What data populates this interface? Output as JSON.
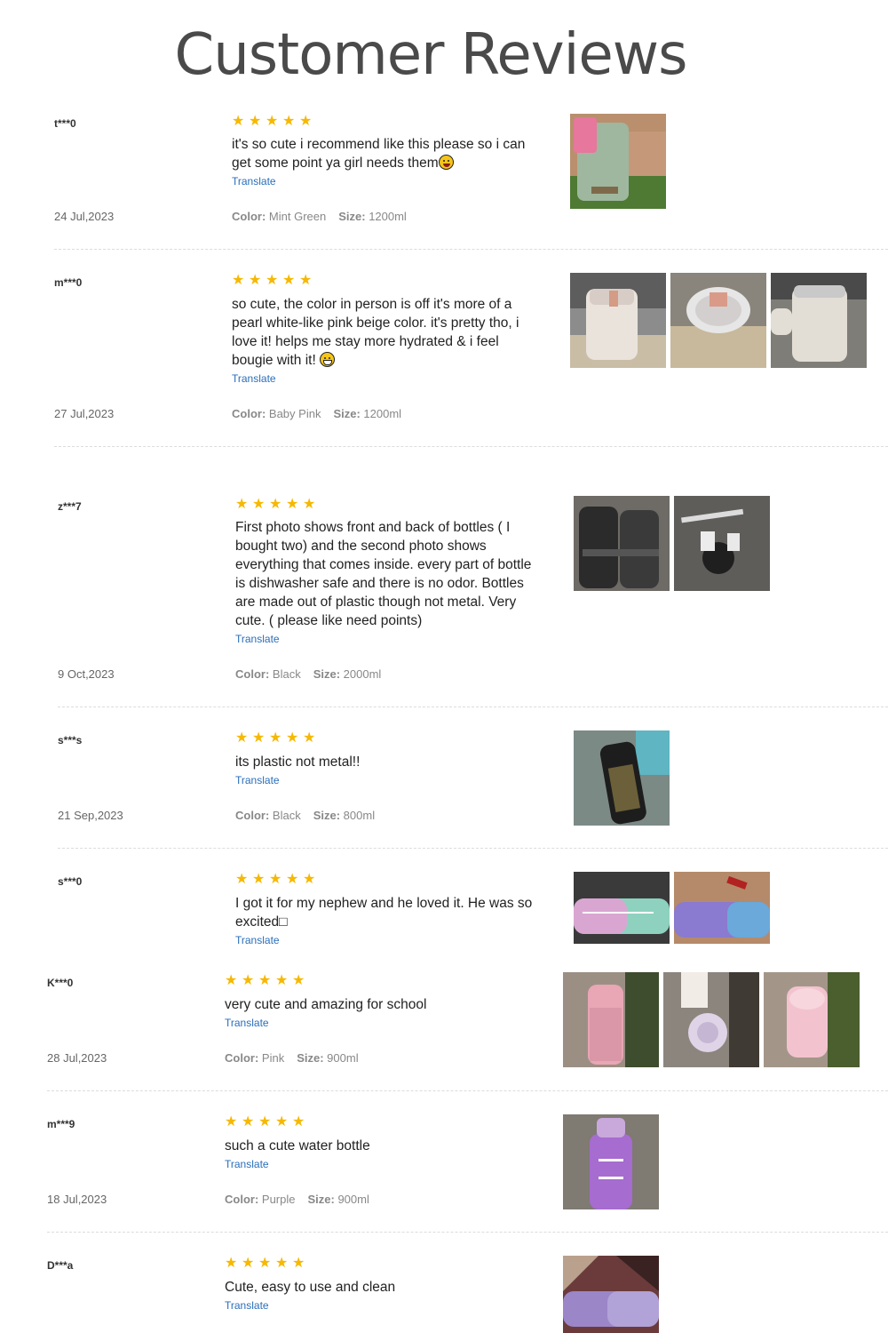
{
  "title": "Customer Reviews",
  "stars_icon": "star-icon",
  "star_color": "#f6b800",
  "link_color": "#2a6ebb",
  "reviews": [
    {
      "user": "t***0",
      "rating": 5,
      "text": "it's so cute i recommend like this please so i can get some point ya girl needs them",
      "translate": "Translate",
      "date": "24 Jul,2023",
      "color_label": "Color:",
      "color": "Mint Green",
      "size_label": "Size:",
      "size": "1200ml"
    },
    {
      "user": "m***0",
      "rating": 5,
      "text": "so cute, the color in person is off it's more of a pearl white-like pink beige color. it's pretty tho, i love it! helps me stay more hydrated & i feel bougie with it!",
      "translate": "Translate",
      "date": "27 Jul,2023",
      "color_label": "Color:",
      "color": "Baby Pink",
      "size_label": "Size:",
      "size": "1200ml"
    },
    {
      "user": "z***7",
      "rating": 5,
      "text": "First photo shows front and back of bottles ( I bought two) and the second photo shows everything that comes inside. every part of bottle is dishwasher safe and there is no odor. Bottles are made out of plastic though not metal. Very cute. ( please like need points)",
      "translate": "Translate",
      "date": "9 Oct,2023",
      "color_label": "Color:",
      "color": "Black",
      "size_label": "Size:",
      "size": "2000ml"
    },
    {
      "user": "s***s",
      "rating": 5,
      "text": "its plastic not metal!!",
      "translate": "Translate",
      "date": "21 Sep,2023",
      "color_label": "Color:",
      "color": "Black",
      "size_label": "Size:",
      "size": "800ml"
    },
    {
      "user": "s***0",
      "rating": 5,
      "text": "I got it for my nephew and he loved it. He was so excited□",
      "translate": "Translate"
    },
    {
      "user": "K***0",
      "rating": 5,
      "text": "very cute and amazing for school",
      "translate": "Translate",
      "date": "28 Jul,2023",
      "color_label": "Color:",
      "color": "Pink",
      "size_label": "Size:",
      "size": "900ml"
    },
    {
      "user": "m***9",
      "rating": 5,
      "text": "such a cute water bottle",
      "translate": "Translate",
      "date": "18 Jul,2023",
      "color_label": "Color:",
      "color": "Purple",
      "size_label": "Size:",
      "size": "900ml"
    },
    {
      "user": "D***a",
      "rating": 5,
      "text": "Cute, easy to use and clean",
      "translate": "Translate"
    }
  ]
}
